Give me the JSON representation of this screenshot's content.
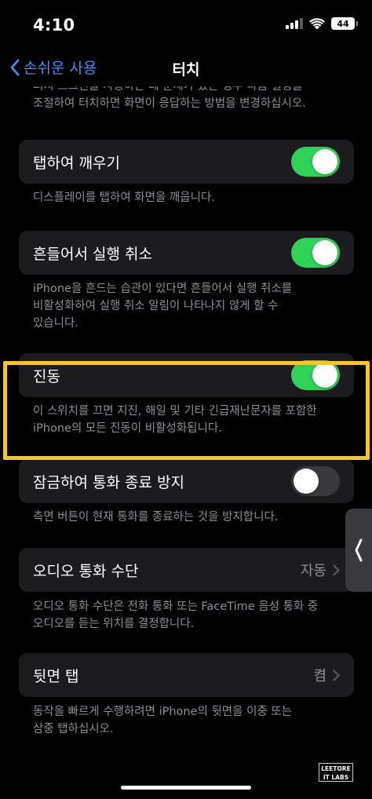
{
  "status": {
    "time": "4:10",
    "battery": "44"
  },
  "nav": {
    "back_label": "손쉬운 사용",
    "title": "터치"
  },
  "top_footer": {
    "line1": "터치 스크린을 사용하는 데 문제가 있는 경우 다음 설정을",
    "line2": "조절하여 터치하면 화면이 응답하는 방법을 변경하십시오."
  },
  "settings": [
    {
      "label": "탭하여 깨우기",
      "toggle": true,
      "footer": [
        "디스플레이를 탭하여 화면을 깨웁니다."
      ]
    },
    {
      "label": "흔들어서 실행 취소",
      "toggle": true,
      "footer": [
        "iPhone을 흔드는 습관이 있다면 흔들어서 실행 취소를",
        "비활성화하여 실행 취소 알림이 나타나지 않게 할 수",
        "있습니다."
      ]
    },
    {
      "label": "진동",
      "toggle": true,
      "footer": [
        "이 스위치를 끄면 지진, 해일 및 기타 긴급재난문자를 포함한",
        "iPhone의 모든 진동이 비활성화됩니다."
      ]
    },
    {
      "label": "잠금하여 통화 종료 방지",
      "toggle": false,
      "footer": [
        "측면 버튼이 현재 통화를 종료하는 것을 방지합니다."
      ]
    },
    {
      "label": "오디오 통화 수단",
      "value": "자동",
      "footer": [
        "오디오 통화 수단은 전화 통화 또는 FaceTime 음성 통화 중",
        "오디오를 듣는 위치를 결정합니다."
      ]
    },
    {
      "label": "뒷면 탭",
      "value": "켬",
      "footer": [
        "동작을 빠르게 수행하려면 iPhone의 뒷면을 이중 또는",
        "삼중 탭하십시오."
      ]
    }
  ],
  "watermark": {
    "line1": "LEETORE",
    "line2": "IT LABS"
  },
  "colors": {
    "accent": "#3d8ff5",
    "toggle_on": "#30d158",
    "highlight": "#f5c530",
    "cell_bg": "#1c1c1e",
    "secondary_text": "#8e8e93"
  }
}
